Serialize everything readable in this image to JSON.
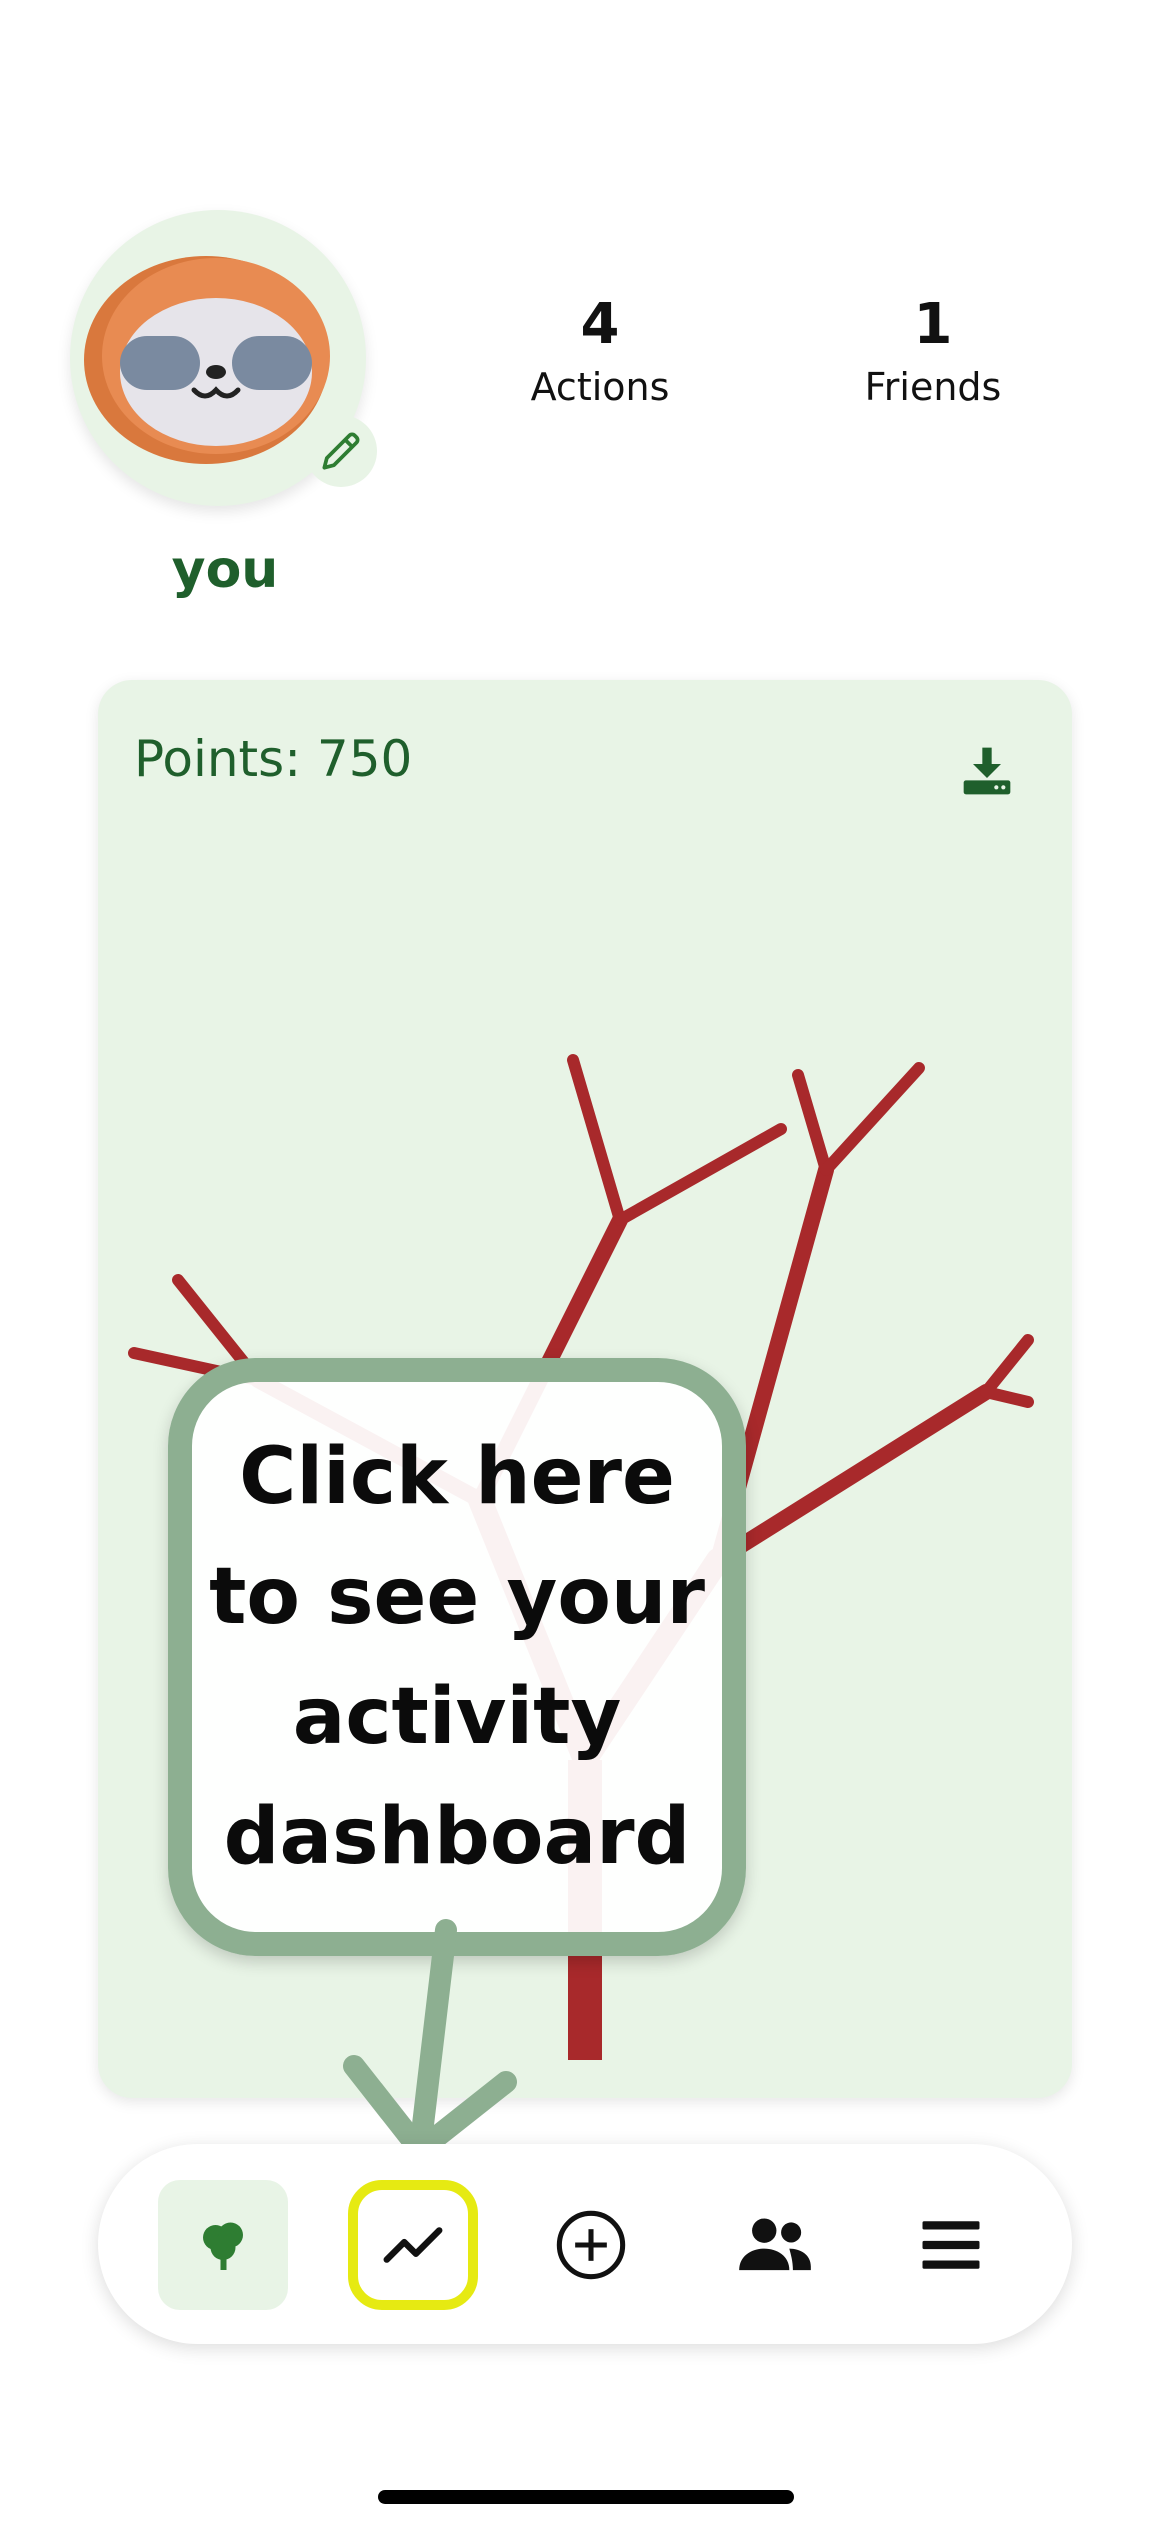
{
  "profile": {
    "username": "you",
    "avatar_icon": "sloth-avatar-icon",
    "edit_icon": "pencil-icon"
  },
  "stats": {
    "actions": {
      "value": "4",
      "label": "Actions"
    },
    "friends": {
      "value": "1",
      "label": "Friends"
    }
  },
  "tree_card": {
    "points_label": "Points: 750",
    "download_icon": "download-icon",
    "tree_color": "#a8292b",
    "background": "#e8f4e6"
  },
  "tooltip": {
    "text": "Click here to see your activity dashboard",
    "border_color": "#8daf91"
  },
  "nav": {
    "items": [
      {
        "name": "tree",
        "icon": "tree-icon",
        "active": true
      },
      {
        "name": "dashboard",
        "icon": "trend-chart-icon",
        "highlighted": true
      },
      {
        "name": "add",
        "icon": "plus-circle-icon"
      },
      {
        "name": "friends",
        "icon": "people-icon"
      },
      {
        "name": "menu",
        "icon": "hamburger-menu-icon"
      }
    ],
    "highlight_color": "#e6ea12"
  },
  "colors": {
    "brand_green": "#1f5f2c",
    "light_green": "#e8f4e6"
  }
}
